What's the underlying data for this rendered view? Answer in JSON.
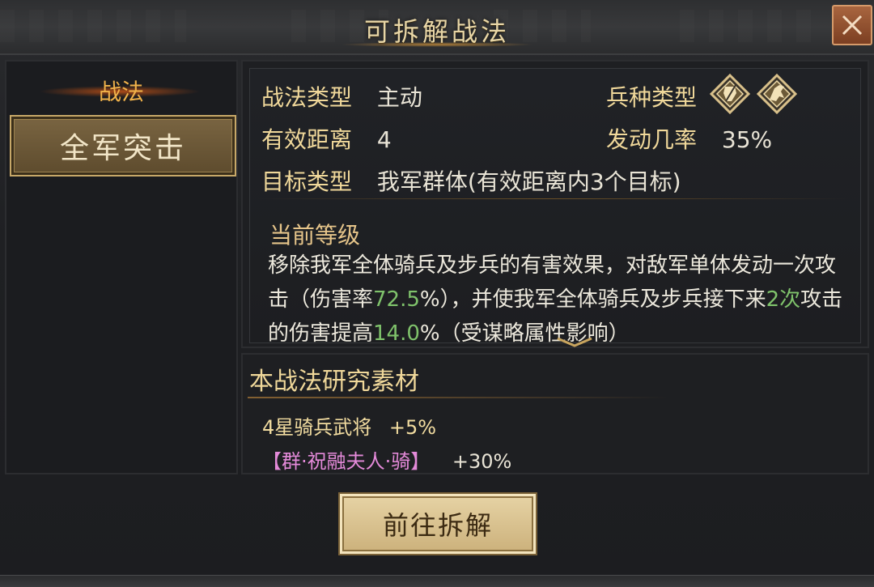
{
  "window": {
    "title": "可拆解战法",
    "close_icon": "close-icon"
  },
  "sidebar": {
    "header": "战法",
    "selected_skill": "全军突击"
  },
  "skill_info": {
    "type_label": "战法类型",
    "type_value": "主动",
    "troop_label": "兵种类型",
    "troop_icons": [
      "cavalry-icon",
      "infantry-icon"
    ],
    "range_label": "有效距离",
    "range_value": "4",
    "chance_label": "发动几率",
    "chance_value": "35%",
    "target_label": "目标类型",
    "target_value": "我军群体(有效距离内3个目标)",
    "grade_title": "当前等级",
    "desc_part1": "移除我军全体骑兵及步兵的有害效果，对敌军单体发动一次攻",
    "desc_part2a": "击（伤害率",
    "desc_hl1": "72.5",
    "desc_part2b": "%），并使我军全体骑兵及步兵接下来",
    "desc_hl2": "2次",
    "desc_part2c": "攻击",
    "desc_part3a": "的伤害提高",
    "desc_hl3": "14.0",
    "desc_part3b": "%（受谋略属性影响）",
    "highlight_color": "#7fc26b"
  },
  "materials": {
    "title": "本战法研究素材",
    "items": [
      {
        "name": "4星骑兵武将",
        "bonus": "+5%"
      },
      {
        "name": "【群·祝融夫人·骑】",
        "bonus": "+30%"
      }
    ]
  },
  "actions": {
    "go_label": "前往拆解"
  }
}
